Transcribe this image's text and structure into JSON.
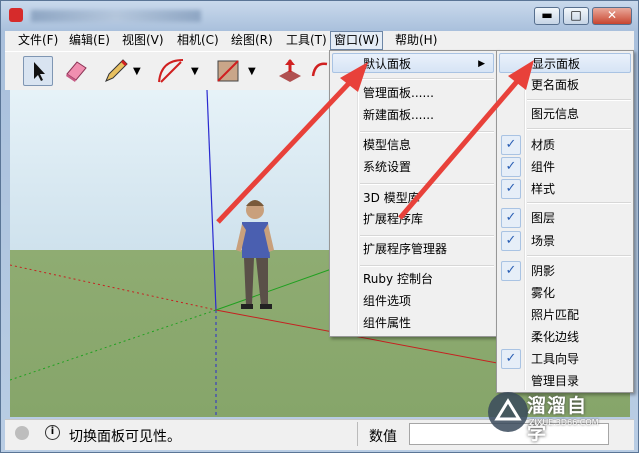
{
  "window": {
    "minimize_label": "▬",
    "maximize_label": "□",
    "close_label": "✕"
  },
  "menubar": {
    "items": [
      "文件(F)",
      "编辑(E)",
      "视图(V)",
      "相机(C)",
      "绘图(R)",
      "工具(T)",
      "窗口(W)",
      "帮助(H)"
    ],
    "active": "窗口(W)"
  },
  "toolbar": {
    "tools": [
      "select-tool",
      "eraser-tool",
      "pencil-tool",
      "arc-tool",
      "shape-tool",
      "push-pull-tool",
      "rotate-tool"
    ]
  },
  "window_menu": {
    "items": [
      {
        "label": "默认面板",
        "submenu": true
      },
      {
        "label": "管理面板......"
      },
      {
        "label": "新建面板......"
      },
      {
        "label": "模型信息"
      },
      {
        "label": "系统设置"
      },
      {
        "label": "3D 模型库"
      },
      {
        "label": "扩展程序库"
      },
      {
        "label": "扩展程序管理器"
      },
      {
        "label": "Ruby 控制台"
      },
      {
        "label": "组件选项"
      },
      {
        "label": "组件属性"
      }
    ]
  },
  "panels_menu": {
    "items": [
      {
        "label": "显示面板",
        "checked": false,
        "highlighted": true
      },
      {
        "label": "更名面板",
        "checked": false
      },
      {
        "label": "图元信息",
        "checked": false
      },
      {
        "label": "材质",
        "checked": true
      },
      {
        "label": "组件",
        "checked": true
      },
      {
        "label": "样式",
        "checked": true
      },
      {
        "label": "图层",
        "checked": true
      },
      {
        "label": "场景",
        "checked": true
      },
      {
        "label": "阴影",
        "checked": true
      },
      {
        "label": "雾化",
        "checked": false
      },
      {
        "label": "照片匹配",
        "checked": false
      },
      {
        "label": "柔化边线",
        "checked": false
      },
      {
        "label": "工具向导",
        "checked": true
      },
      {
        "label": "管理目录",
        "checked": false
      }
    ]
  },
  "statusbar": {
    "message": "切换面板可见性。",
    "measurements_label": "数值"
  },
  "watermark": {
    "title": "溜溜自学",
    "url": "ZIXUE.3D66.COM"
  },
  "colors": {
    "arrow": "#e8413a",
    "check": "#2b5fb4",
    "highlight": "#d6e4f5"
  }
}
